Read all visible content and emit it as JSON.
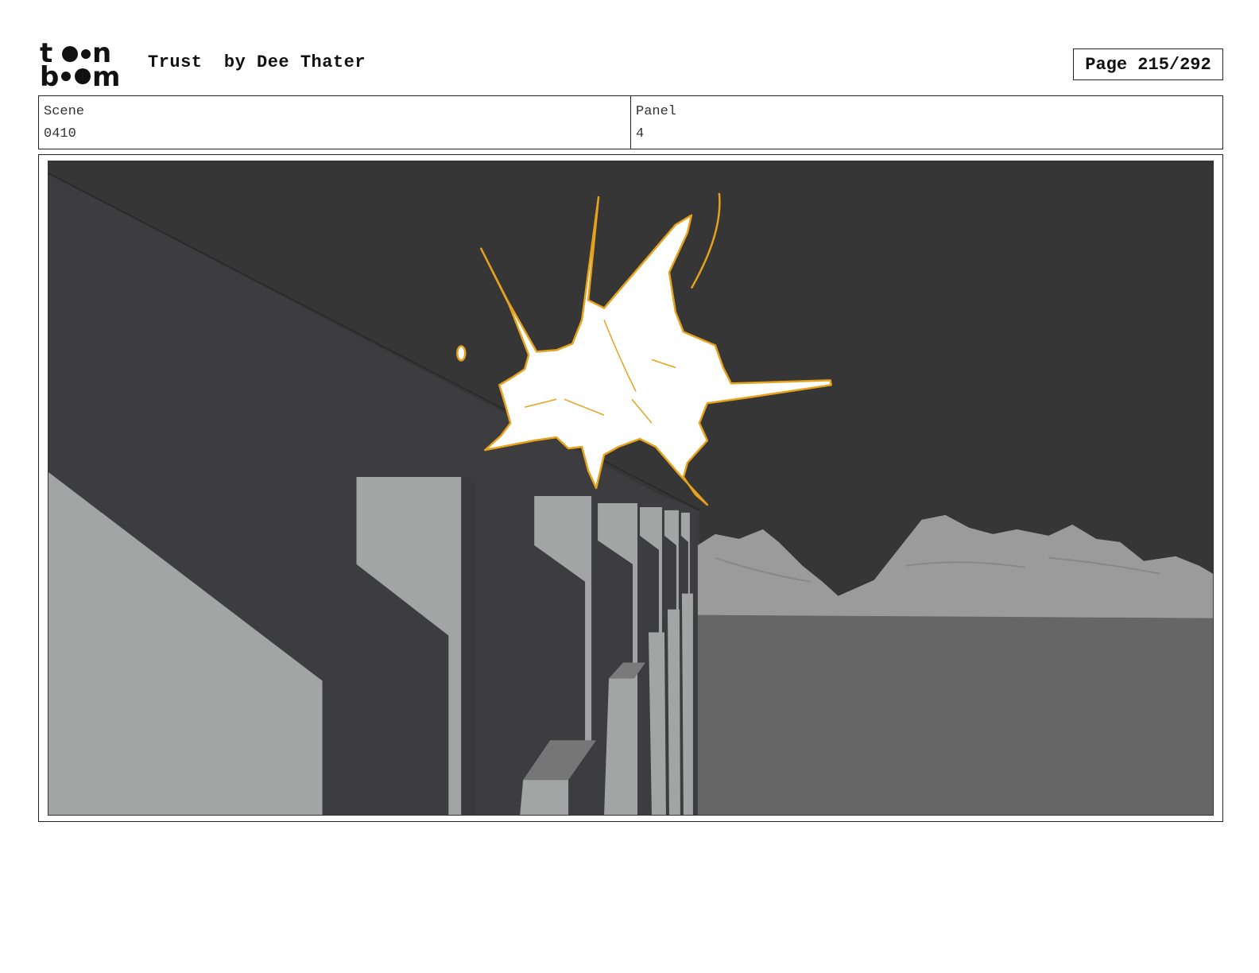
{
  "header": {
    "logo_text": "toon boom",
    "title": "Trust  by Dee Thater",
    "page_label": "Page 215/292"
  },
  "info": {
    "scene_label": "Scene",
    "scene_value": "0410",
    "panel_label": "Panel",
    "panel_value": "4"
  },
  "panel": {
    "description": "storyboard-drawing",
    "colors": {
      "sky": "#363636",
      "wall_dark": "#3c3b3d",
      "wall_light": "#a2a3a3",
      "ground": "#666667",
      "mountains": "#9a9a9a",
      "explosion_fill": "#ffffff",
      "explosion_line": "#e6a21c"
    }
  }
}
